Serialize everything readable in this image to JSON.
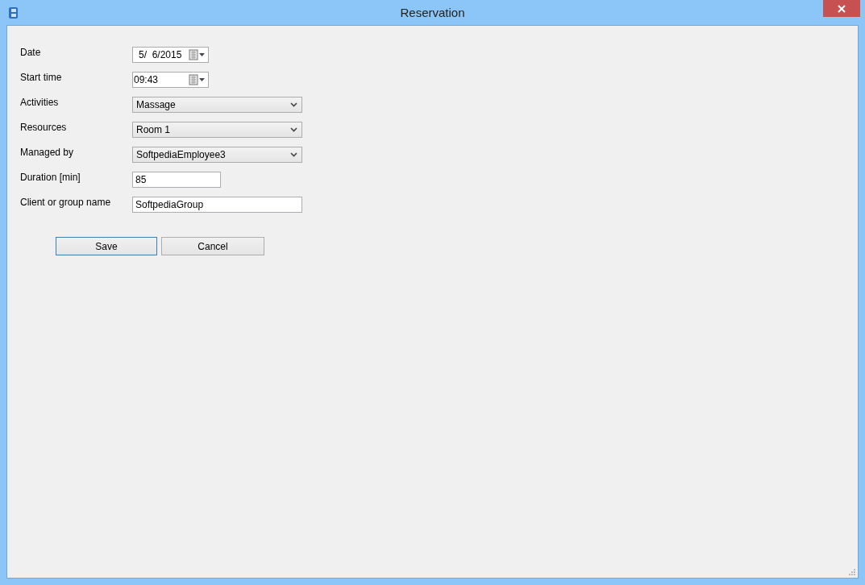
{
  "window": {
    "title": "Reservation"
  },
  "fields": [
    {
      "label": "Date",
      "kind": "date",
      "value": "5/  6/2015"
    },
    {
      "label": "Start time",
      "kind": "time",
      "value": "09:43"
    },
    {
      "label": "Activities",
      "kind": "select",
      "value": "Massage"
    },
    {
      "label": "Resources",
      "kind": "select",
      "value": "Room 1"
    },
    {
      "label": "Managed by",
      "kind": "select",
      "value": "SoftpediaEmployee3"
    },
    {
      "label": "Duration [min]",
      "kind": "short",
      "value": "85"
    },
    {
      "label": "Client or group name",
      "kind": "text",
      "value": "SoftpediaGroup"
    }
  ],
  "buttons": [
    {
      "label": "Save",
      "focused": true
    },
    {
      "label": "Cancel",
      "focused": false
    }
  ]
}
